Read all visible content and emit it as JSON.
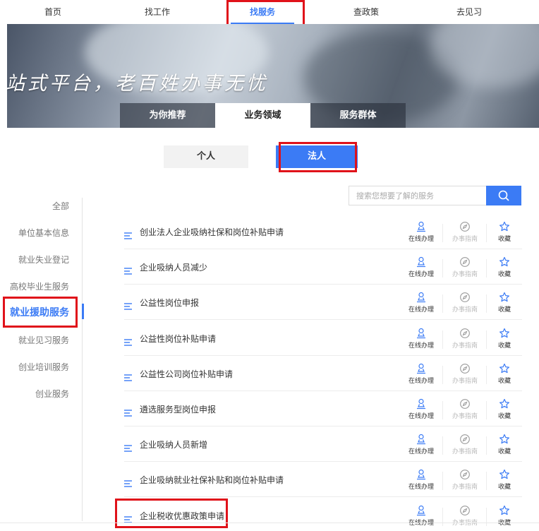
{
  "topnav": {
    "items": [
      {
        "label": "首页"
      },
      {
        "label": "找工作"
      },
      {
        "label": "找服务"
      },
      {
        "label": "查政策"
      },
      {
        "label": "去见习"
      }
    ],
    "active_index": 2
  },
  "banner": {
    "slogan": "站式平台，老百姓办事无忧",
    "tabs": [
      {
        "label": "为你推荐"
      },
      {
        "label": "业务领域"
      },
      {
        "label": "服务群体"
      }
    ],
    "active_tab": 1
  },
  "toggle": {
    "personal_label": "个人",
    "legal_label": "法人",
    "active": "法人"
  },
  "sidebar": {
    "items": [
      {
        "label": "全部"
      },
      {
        "label": "单位基本信息"
      },
      {
        "label": "就业失业登记"
      },
      {
        "label": "高校毕业生服务"
      },
      {
        "label": "就业援助服务"
      },
      {
        "label": "就业见习服务"
      },
      {
        "label": "创业培训服务"
      },
      {
        "label": "创业服务"
      }
    ],
    "active_index": 4
  },
  "search": {
    "placeholder": "搜索您想要了解的服务"
  },
  "actions": {
    "online_label": "在线办理",
    "guide_label": "办事指南",
    "favorite_label": "收藏"
  },
  "services": [
    {
      "title": "创业法人企业吸纳社保和岗位补贴申请"
    },
    {
      "title": "企业吸纳人员减少"
    },
    {
      "title": "公益性岗位申报"
    },
    {
      "title": "公益性岗位补贴申请"
    },
    {
      "title": "公益性公司岗位补贴申请"
    },
    {
      "title": "遴选服务型岗位申报"
    },
    {
      "title": "企业吸纳人员新增"
    },
    {
      "title": "企业吸纳就业社保补贴和岗位补贴申请"
    },
    {
      "title": "企业税收优惠政策申请"
    }
  ],
  "colors": {
    "accent": "#3b7bf5",
    "highlight": "#e0121a"
  }
}
